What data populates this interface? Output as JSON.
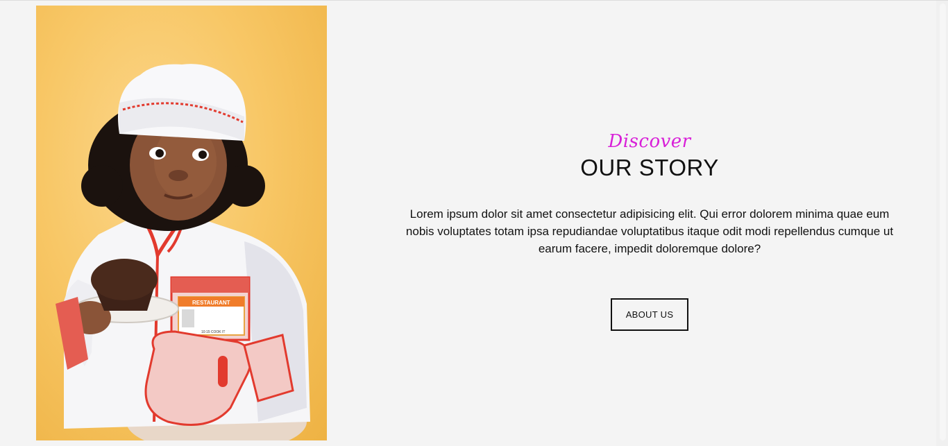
{
  "hero": {
    "image_alt": "child in chef outfit holding a cupcake",
    "badge_text": "RESTAURANT",
    "badge_subtext": "10:15 COOK IT"
  },
  "story": {
    "kicker": "Discover",
    "title": "OUR STORY",
    "body": "Lorem ipsum dolor sit amet consectetur adipisicing elit. Qui error dolorem minima quae eum nobis voluptates totam ipsa repudiandae voluptatibus itaque odit modi repellendus cumque ut earum facere, impedit doloremque dolore?",
    "button_label": "ABOUT US"
  },
  "colors": {
    "accent": "#d81fd8",
    "background": "#f4f4f4",
    "text": "#111111"
  }
}
